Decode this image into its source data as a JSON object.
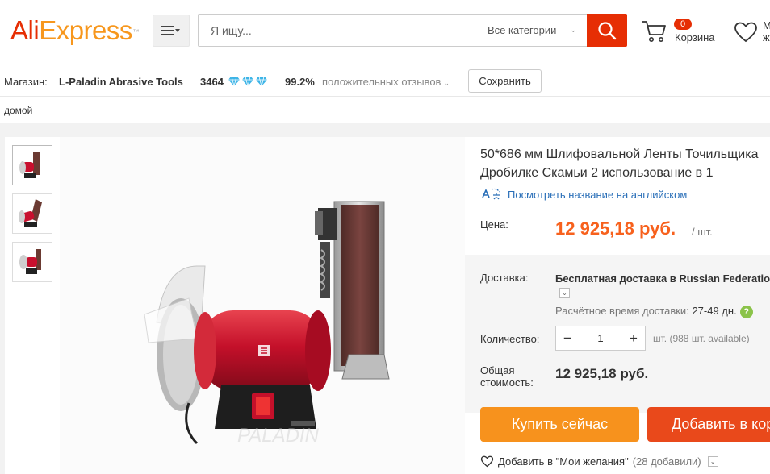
{
  "header": {
    "logo_ali": "Ali",
    "logo_express": "Express",
    "logo_tm": "™",
    "search_placeholder": "Я ищу...",
    "search_category": "Все категории",
    "cart_count": "0",
    "cart_label": "Корзина",
    "wishlist_label_line1": "М",
    "wishlist_label_line2": "ж"
  },
  "store": {
    "label": "Магазин:",
    "name": "L-Paladin Abrasive Tools",
    "score": "3464",
    "positive_percent": "99.2%",
    "positive_text": "положительных отзывов",
    "save_label": "Сохранить"
  },
  "breadcrumb": {
    "home": "домой"
  },
  "product": {
    "title_line1": "50*686 мм Шлифовальной Ленты Точильщика",
    "title_line2": "Дробилке Скамьи 2 использование в 1",
    "translate_link": "Посмотреть название на английском",
    "price_label": "Цена:",
    "price": "12 925,18 руб.",
    "price_unit": "/ шт.",
    "shipping_label": "Доставка:",
    "shipping_value": "Бесплатная доставка в Russian Federation",
    "eta_label": "Расчётное время доставки:",
    "eta_value": "27-49 дн.",
    "quantity_label": "Количество:",
    "quantity": "1",
    "stock": "шт. (988 шт. available)",
    "total_label": "Общая стоимость:",
    "total_value": "12 925,18 руб.",
    "buy_now": "Купить сейчас",
    "add_to_cart": "Добавить в корзину",
    "wishlist_text": "Добавить в \"Мои желания\"",
    "wishlist_count": "(28 добавили)"
  },
  "colors": {
    "brand_red": "#e62e04",
    "brand_orange": "#f7971d",
    "price_orange": "#f7611d",
    "buy_button": "#f7921d",
    "cart_button": "#e9491b",
    "link_blue": "#2a6fb8"
  }
}
